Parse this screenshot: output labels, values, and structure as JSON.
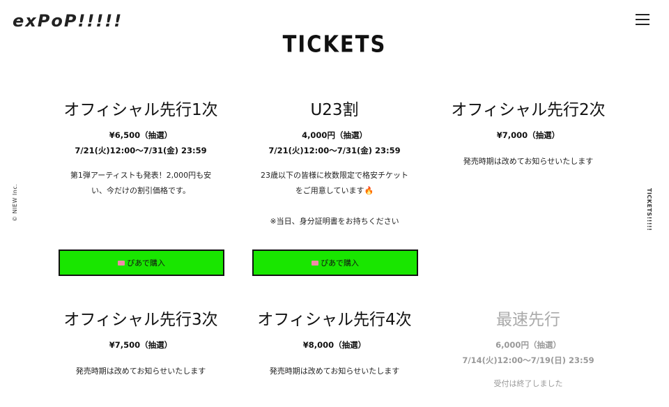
{
  "header": {
    "logo": "exPoP!!!!!",
    "page_title": "TICKETS"
  },
  "side": {
    "left_text": "© NIEW Inc.",
    "right_text": "TICKETS!!!!!"
  },
  "tickets": [
    {
      "title": "オフィシャル先行1次",
      "price": "¥6,500（抽選）",
      "period": "7/21(火)12:00〜7/31(金) 23:59",
      "desc": [
        "第1弾アーティストも発表！2,000円も安",
        "い、今だけの割引価格です。"
      ],
      "button": "ぴあで購入"
    },
    {
      "title": "U23割",
      "price": "4,000円（抽選）",
      "period": "7/21(火)12:00〜7/31(金) 23:59",
      "desc": [
        "23歳以下の皆様に枚数限定で格安チケット",
        "をご用意しています🔥",
        "",
        "※当日、身分証明書をお持ちください"
      ],
      "button": "ぴあで購入"
    },
    {
      "title": "オフィシャル先行2次",
      "price": "¥7,000（抽選）",
      "desc": [
        "発売時期は改めてお知らせいたします"
      ]
    },
    {
      "title": "オフィシャル先行3次",
      "price": "¥7,500（抽選）",
      "desc": [
        "発売時期は改めてお知らせいたします"
      ]
    },
    {
      "title": "オフィシャル先行4次",
      "price": "¥8,000（抽選）",
      "desc": [
        "発売時期は改めてお知らせいたします"
      ]
    },
    {
      "title": "最速先行",
      "price": "6,000円（抽選）",
      "period": "7/14(火)12:00〜7/19(日) 23:59",
      "desc": [
        "受付は終了しました"
      ]
    }
  ],
  "colors": {
    "button_bg": "#19e600",
    "closed_text": "#999999"
  },
  "icons": {
    "menu": "hamburger-icon",
    "button": "ticket-icon"
  }
}
